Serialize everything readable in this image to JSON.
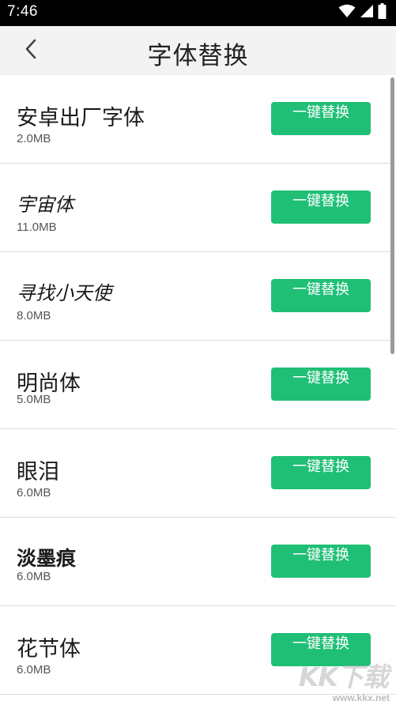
{
  "status_bar": {
    "time": "7:46",
    "icons": [
      "wifi-icon",
      "signal-icon",
      "battery-icon"
    ]
  },
  "header": {
    "title": "字体替换",
    "back_icon": "chevron-left-icon"
  },
  "fonts": [
    {
      "name": "安卓出厂字体",
      "size": "2.0MB",
      "button": "一键替换"
    },
    {
      "name": "宇宙体",
      "size": "11.0MB",
      "button": "一键替换"
    },
    {
      "name": "寻找小天使",
      "size": "8.0MB",
      "button": "一键替换"
    },
    {
      "name": "明尚体",
      "size": "5.0MB",
      "button": "一键替换"
    },
    {
      "name": "眼泪",
      "size": "6.0MB",
      "button": "一键替换"
    },
    {
      "name": "淡墨痕",
      "size": "6.0MB",
      "button": "一键替换"
    },
    {
      "name": "花节体",
      "size": "6.0MB",
      "button": "一键替换"
    }
  ],
  "watermark": {
    "text": "KK下载",
    "url": "www.kkx.net"
  },
  "colors": {
    "button": "#1fbf76",
    "header_bg": "#f3f3f3",
    "status_bar": "#000000"
  }
}
